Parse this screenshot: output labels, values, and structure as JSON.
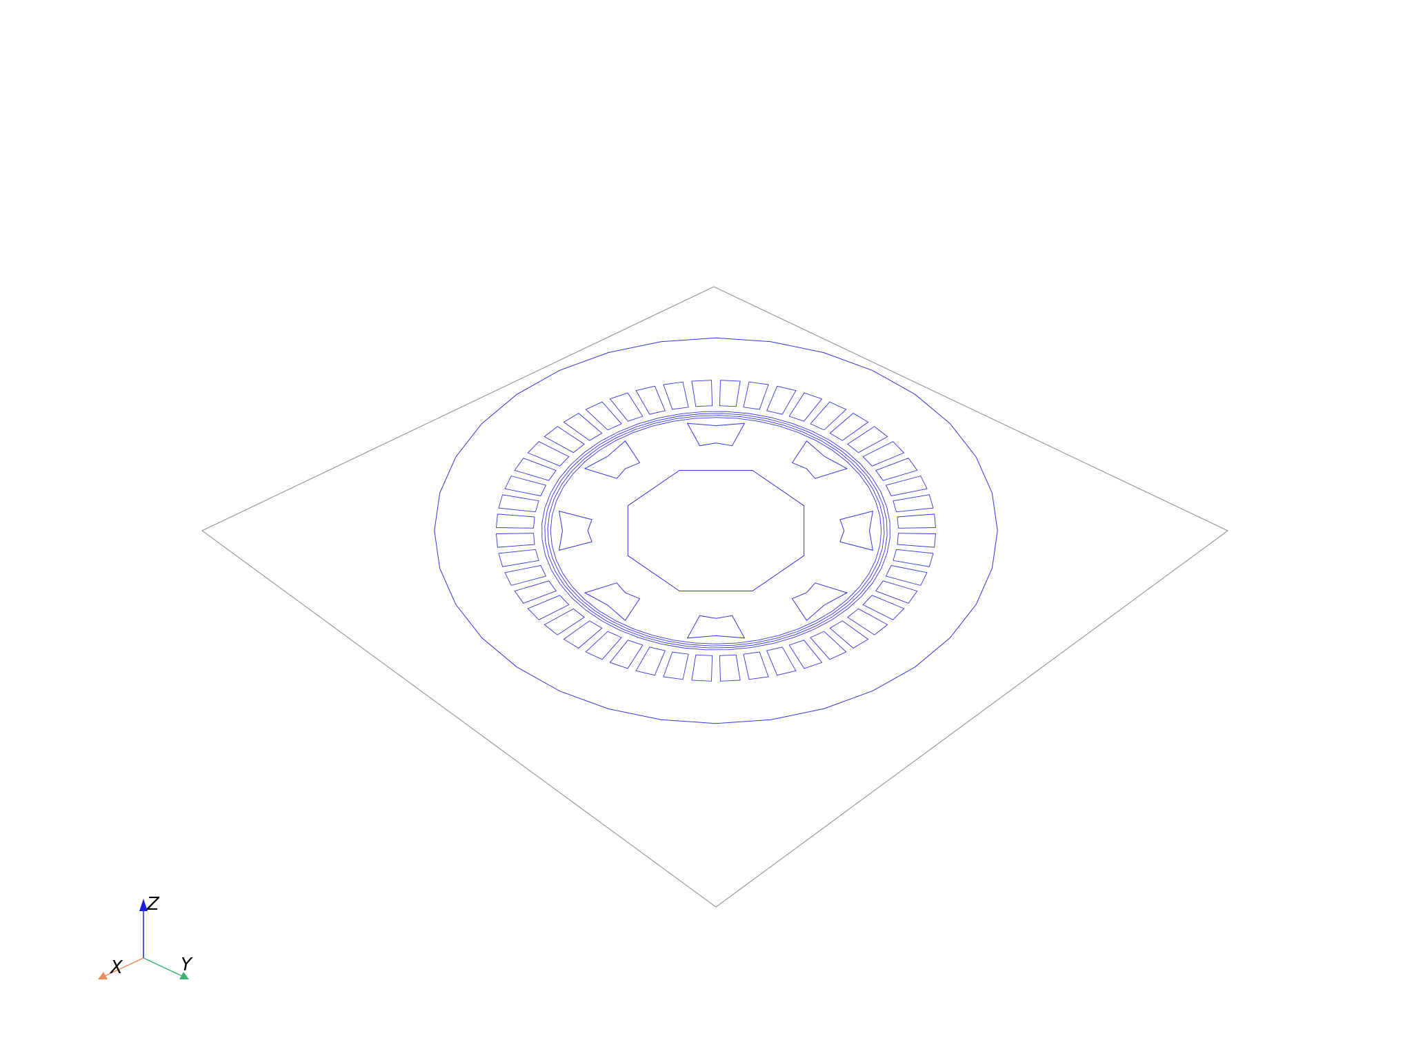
{
  "colors": {
    "background": "#ffffff",
    "model_edges": "#3333dd",
    "plane_edges": "#999999",
    "axis_x": "#f08a5d",
    "axis_y": "#3cb371",
    "axis_z": "#1c1cdc"
  },
  "axis_triad": {
    "x_label": "X",
    "y_label": "Y",
    "z_label": "Z"
  },
  "model": {
    "view": "isometric",
    "render_mode": "wireframe",
    "stator_slot_count": 48,
    "rotor_pole_count": 8,
    "rotor_shaft_sides": 8
  }
}
